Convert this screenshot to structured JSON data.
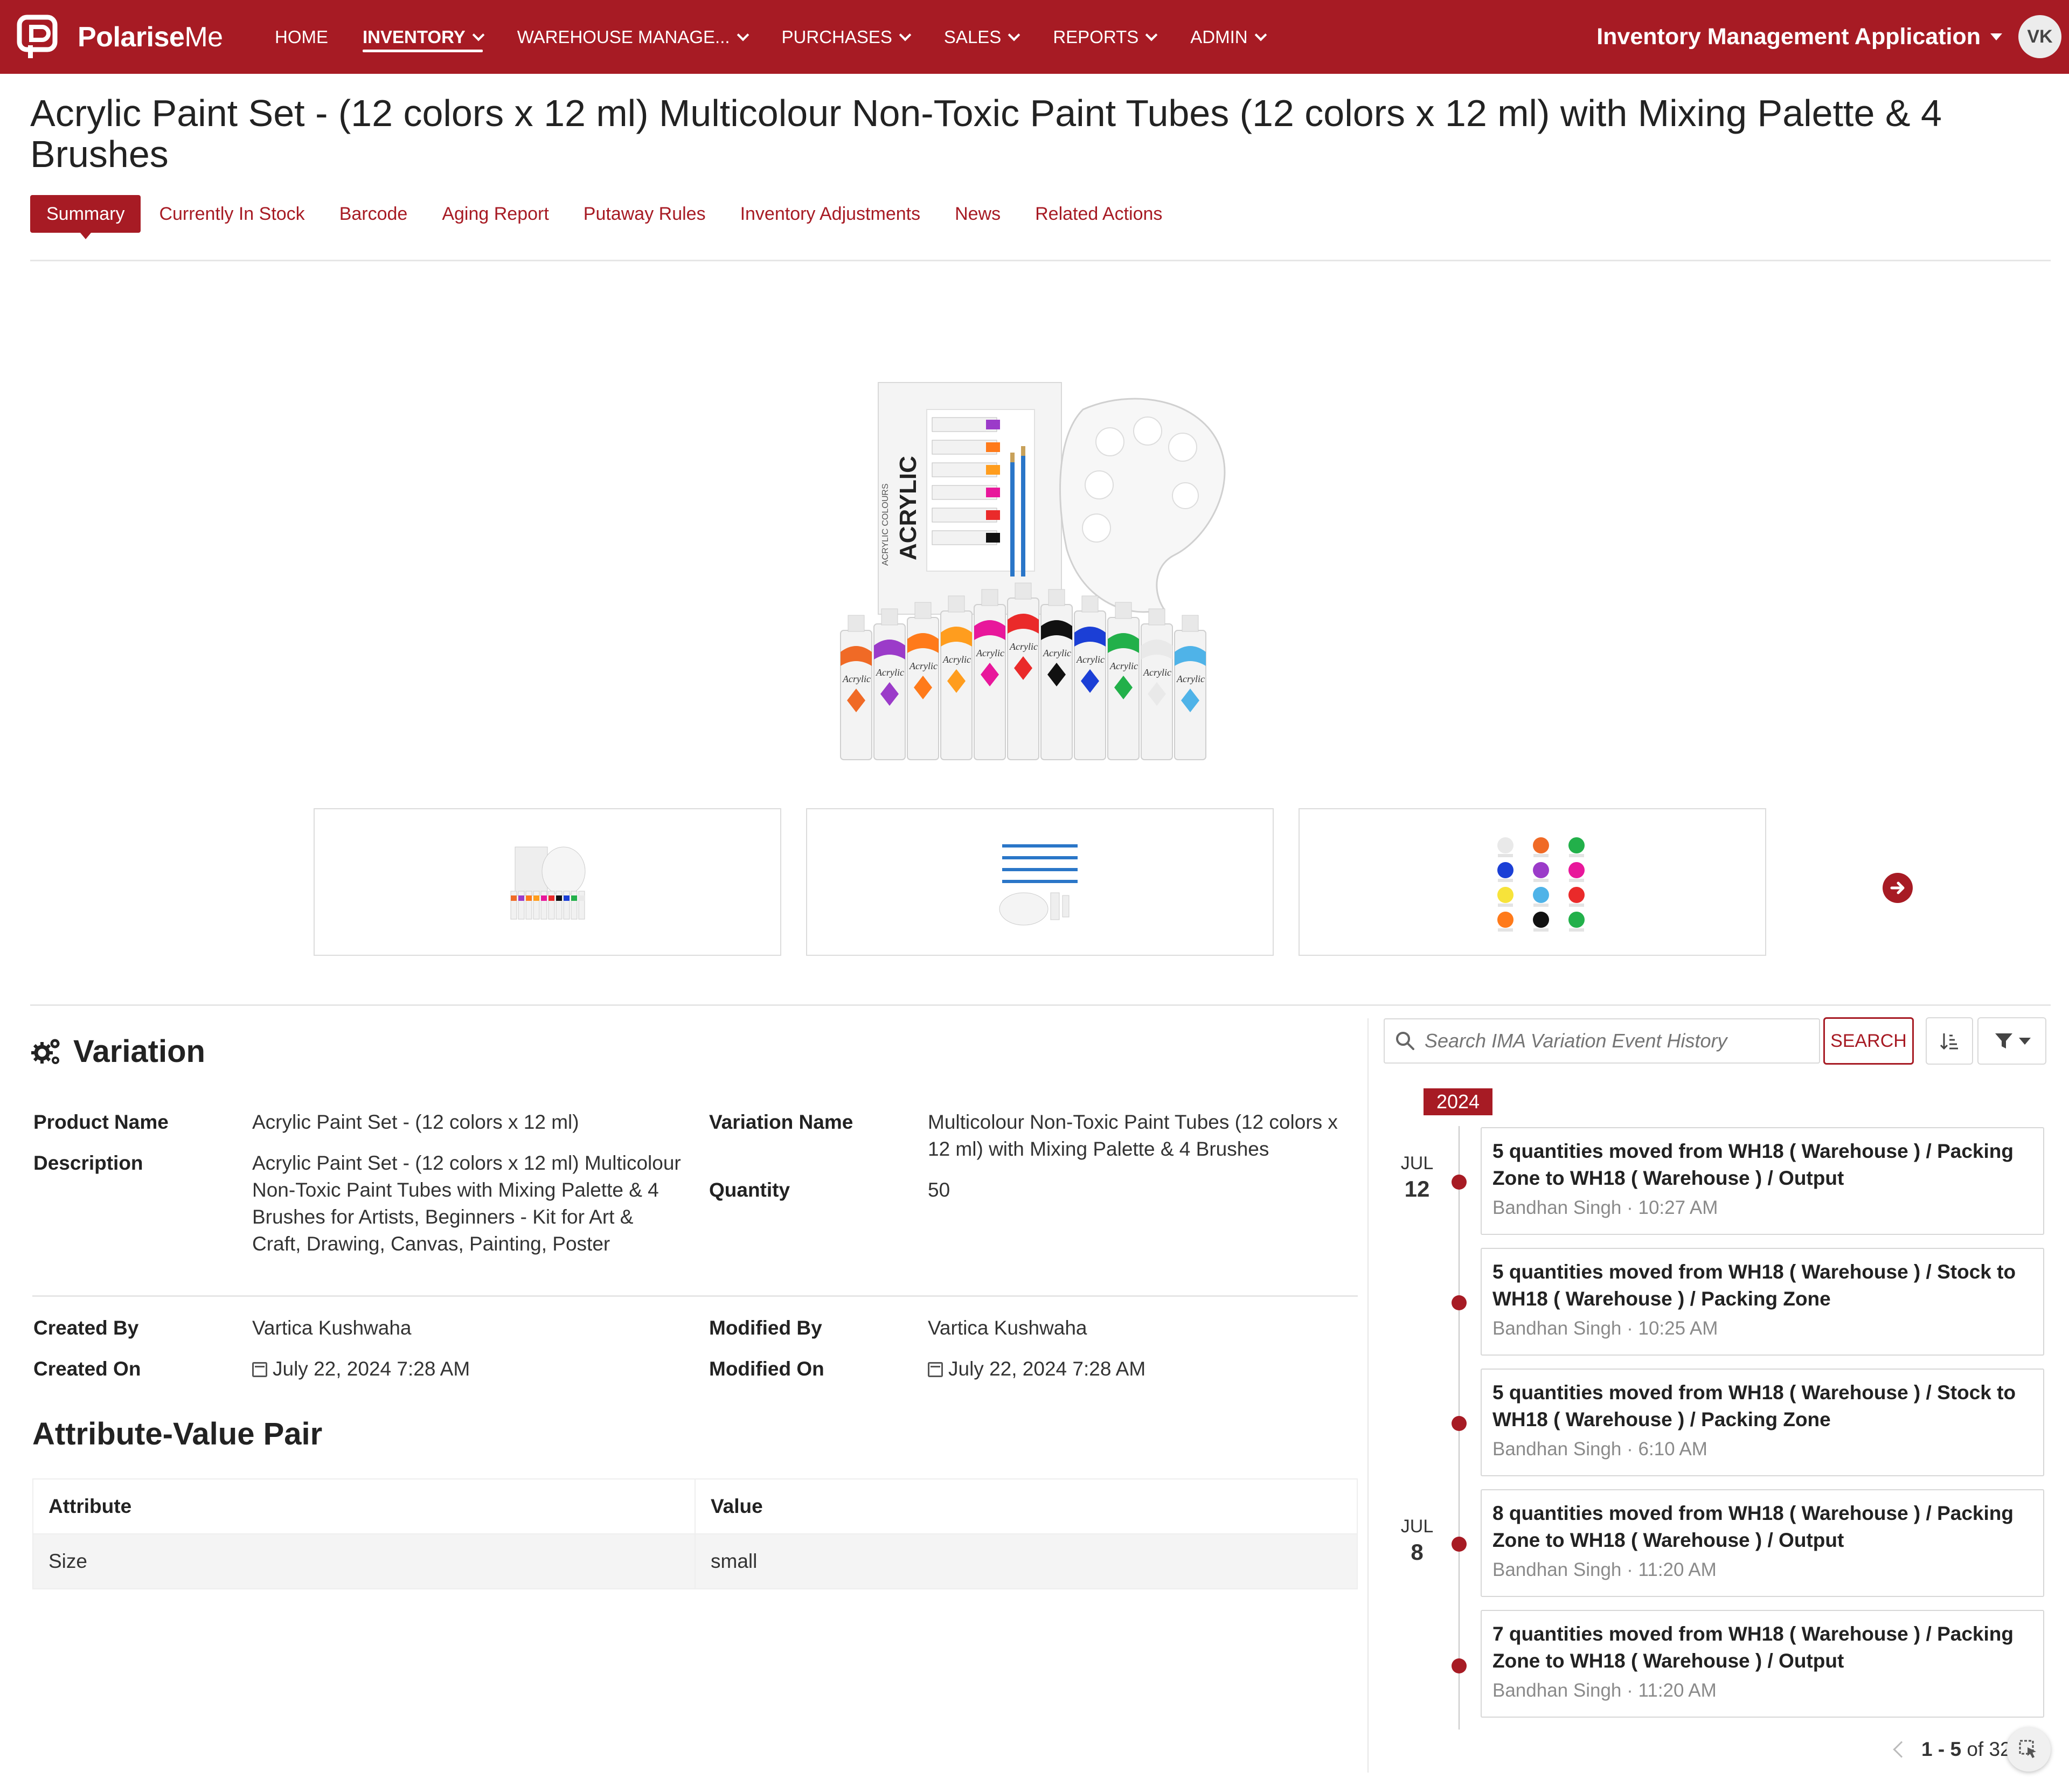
{
  "brand": {
    "name_bold": "Polarise",
    "name_light": "Me"
  },
  "nav": {
    "items": [
      {
        "label": "HOME",
        "has_menu": false
      },
      {
        "label": "INVENTORY",
        "has_menu": true,
        "active": true
      },
      {
        "label": "WAREHOUSE MANAGE...",
        "has_menu": true
      },
      {
        "label": "PURCHASES",
        "has_menu": true
      },
      {
        "label": "SALES",
        "has_menu": true
      },
      {
        "label": "REPORTS",
        "has_menu": true
      },
      {
        "label": "ADMIN",
        "has_menu": true
      }
    ],
    "app_title": "Inventory Management Application",
    "avatar_initials": "VK"
  },
  "page": {
    "title": "Acrylic Paint Set - (12 colors x 12 ml) Multicolour Non-Toxic Paint Tubes (12 colors x 12 ml) with Mixing Palette & 4 Brushes"
  },
  "tabs": [
    "Summary",
    "Currently In Stock",
    "Barcode",
    "Aging Report",
    "Putaway Rules",
    "Inventory Adjustments",
    "News",
    "Related Actions"
  ],
  "hero": {
    "box_label": "ACRYLIC",
    "box_sublabel": "ACRYLIC COLOURS",
    "tube_label": "Acrylic"
  },
  "variation": {
    "heading": "Variation",
    "product_name_label": "Product Name",
    "product_name": "Acrylic Paint Set - (12 colors x 12 ml)",
    "description_label": "Description",
    "description": "Acrylic Paint Set - (12 colors x 12 ml) Multicolour Non-Toxic Paint Tubes with Mixing Palette & 4 Brushes for Artists, Beginners - Kit for Art & Craft, Drawing, Canvas, Painting, Poster",
    "variation_name_label": "Variation Name",
    "variation_name": "Multicolour Non-Toxic Paint Tubes (12 colors x 12 ml) with Mixing Palette & 4 Brushes",
    "quantity_label": "Quantity",
    "quantity": "50",
    "created_by_label": "Created By",
    "created_by": "Vartica Kushwaha",
    "created_on_label": "Created On",
    "created_on": "July 22, 2024 7:28 AM",
    "modified_by_label": "Modified By",
    "modified_by": "Vartica Kushwaha",
    "modified_on_label": "Modified On",
    "modified_on": "July 22, 2024 7:28 AM"
  },
  "attributes": {
    "heading": "Attribute-Value Pair",
    "columns": [
      "Attribute",
      "Value"
    ],
    "rows": [
      {
        "attribute": "Size",
        "value": "small"
      }
    ]
  },
  "history": {
    "search_placeholder": "Search IMA Variation Event History",
    "search_button": "SEARCH",
    "year": "2024",
    "dates": [
      {
        "month": "JUL",
        "day": "12"
      },
      {
        "month": "JUL",
        "day": "8"
      }
    ],
    "events": [
      {
        "title": "5 quantities moved from WH18 ( Warehouse ) / Packing Zone to WH18 ( Warehouse ) / Output",
        "meta": "Bandhan Singh · 10:27 AM"
      },
      {
        "title": "5 quantities moved from WH18 ( Warehouse ) / Stock to WH18 ( Warehouse ) / Packing Zone",
        "meta": "Bandhan Singh · 10:25 AM"
      },
      {
        "title": "5 quantities moved from WH18 ( Warehouse ) / Stock to WH18 ( Warehouse ) / Packing Zone",
        "meta": "Bandhan Singh · 6:10 AM"
      },
      {
        "title": "8 quantities moved from WH18 ( Warehouse ) / Packing Zone to WH18 ( Warehouse ) / Output",
        "meta": "Bandhan Singh · 11:20 AM"
      },
      {
        "title": "7 quantities moved from WH18 ( Warehouse ) / Packing Zone to WH18 ( Warehouse ) / Output",
        "meta": "Bandhan Singh · 11:20 AM"
      }
    ],
    "pager_range": "1 - 5",
    "pager_total": "of 32"
  },
  "colors": {
    "brand": "#a71b24",
    "text": "#222222",
    "muted": "#8a8a8a",
    "border": "#d7d7d7"
  },
  "paint_colors": [
    "#f06a26",
    "#9b3bc9",
    "#ff7a1a",
    "#ff9d1e",
    "#e8179b",
    "#ea2a2a",
    "#111111",
    "#1b3fd6",
    "#22b04a",
    "#e9e9e9",
    "#4fb3e8",
    "#f7e33a"
  ]
}
